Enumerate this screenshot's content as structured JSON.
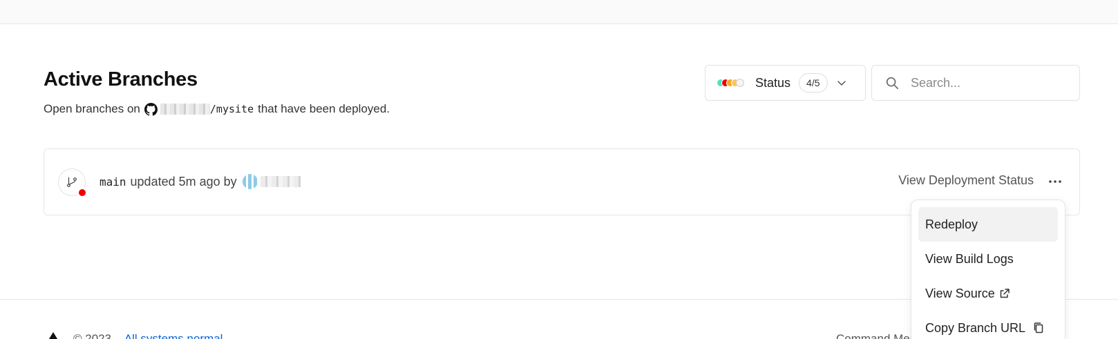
{
  "header": {
    "title": "Active Branches",
    "subtitle_prefix": "Open branches on",
    "repo_path": "/mysite",
    "subtitle_suffix": "that have been deployed."
  },
  "status_filter": {
    "label": "Status",
    "count": "4/5",
    "dot_colors": [
      "#50e3c2",
      "#ee0000",
      "#f5a623",
      "#f5c85c",
      "#eaeaea"
    ]
  },
  "search": {
    "placeholder": "Search..."
  },
  "branch": {
    "name": "main",
    "updated_text": "updated 5m ago by",
    "status_color": "#ee0000",
    "view_status_label": "View Deployment Status"
  },
  "menu": {
    "items": [
      {
        "label": "Redeploy",
        "active": true
      },
      {
        "label": "View Build Logs"
      },
      {
        "label": "View Source",
        "icon": "external-link-icon"
      },
      {
        "label": "Copy Branch URL",
        "icon": "copy-icon"
      }
    ]
  },
  "footer": {
    "copyright": "© 2023",
    "status_link": "All systems normal",
    "right_text": "Command Menu"
  },
  "colors": {
    "accent_link": "#0a66d8",
    "error": "#ee0000"
  }
}
